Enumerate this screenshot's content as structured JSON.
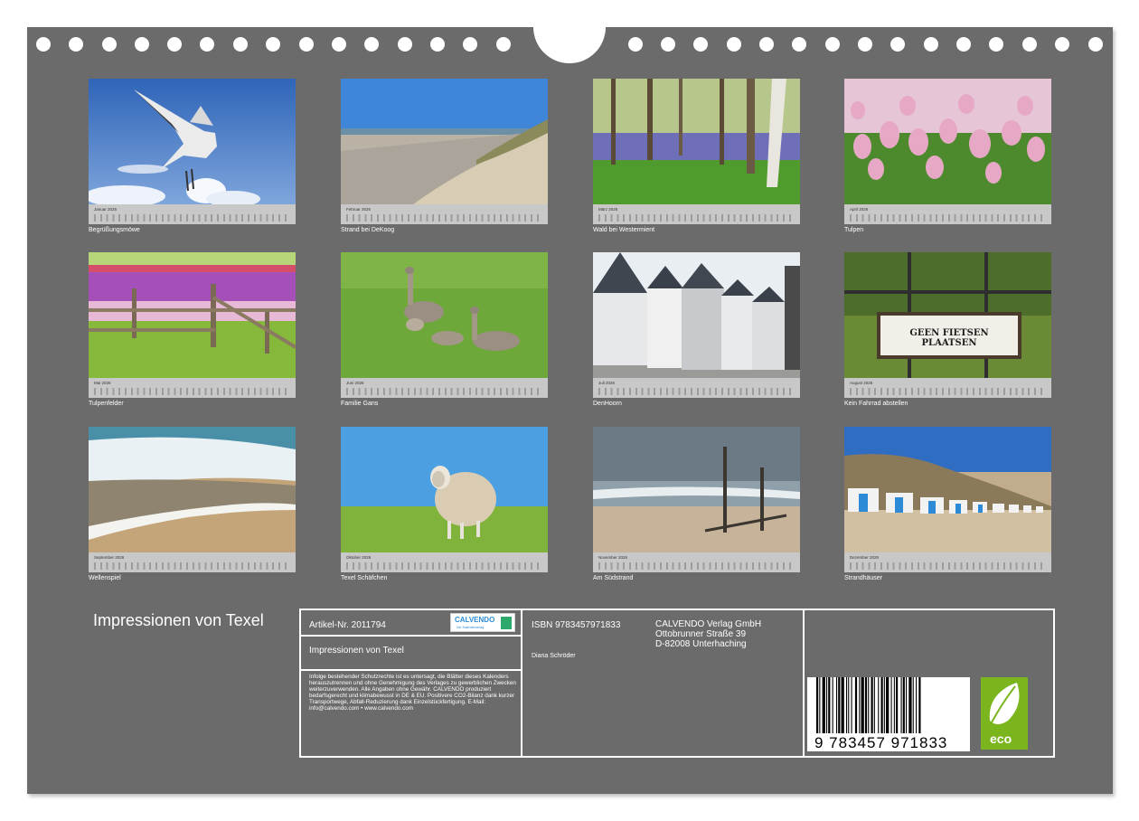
{
  "months": [
    {
      "month": "Januar 2026",
      "caption": "Begrüßungsmöwe",
      "photo": "seagull"
    },
    {
      "month": "Februar 2026",
      "caption": "Strand bei DeKoog",
      "photo": "beach-dunes"
    },
    {
      "month": "März 2026",
      "caption": "Wald bei Westermient",
      "photo": "bluebell-forest"
    },
    {
      "month": "April 2026",
      "caption": "Tulpen",
      "photo": "pink-tulips"
    },
    {
      "month": "Mai 2026",
      "caption": "Tulpenfelder",
      "photo": "tulip-fields-fence"
    },
    {
      "month": "Juni 2026",
      "caption": "Familie Gans",
      "photo": "geese-family"
    },
    {
      "month": "Juli 2026",
      "caption": "DenHoorn",
      "photo": "gabled-houses"
    },
    {
      "month": "August 2026",
      "caption": "Kein Fahrrad abstellen",
      "photo": "sign-geen-fietsen-plaatsen"
    },
    {
      "month": "September 2026",
      "caption": "Wellenspiel",
      "photo": "waves"
    },
    {
      "month": "Oktober 2026",
      "caption": "Texel Schäfchen",
      "photo": "sheep"
    },
    {
      "month": "November 2026",
      "caption": "Am Südstrand",
      "photo": "beach-poles"
    },
    {
      "month": "Dezember 2026",
      "caption": "Strandhäuser",
      "photo": "beach-huts"
    }
  ],
  "sign_text": "GEEN FIETSEN PLAATSEN",
  "title": "Impressionen von Texel",
  "article": "Artikel-Nr. 2011794",
  "logo": {
    "name": "CALVENDO",
    "sub": "Der Kalenderverlag"
  },
  "box_title": "Impressionen von Texel",
  "legal_text": "Infolge bestehender Schutzrechte ist es untersagt, die Blätter dieses Kalenders herauszutrennen und ohne Genehmigung des Verlages zu gewerblichen Zwecken weiterzuverwenden. Alle Angaben ohne Gewähr. CALVENDO produziert bedarfsgerecht und klimabewusst in DE & EU. Positivere CO2-Bilanz dank kurzer Transportwege, Abfall-Reduzierung dank Einzelstückfertigung. E-Mail: info@calvendo.com • www.calvendo.com",
  "isbn": "ISBN 9783457971833",
  "author": "Diana Schröder",
  "publisher": {
    "line1": "CALVENDO Verlag GmbH",
    "line2": "Ottobrunner Straße 39",
    "line3": "D-82008 Unterhaching"
  },
  "barcode_number": "9 783457 971833",
  "eco_label": "eco",
  "colors": {
    "background": "#6b6b6b",
    "strip": "#c8c8c8",
    "eco": "#7ab51d",
    "logo_blue": "#2f8cd3"
  }
}
